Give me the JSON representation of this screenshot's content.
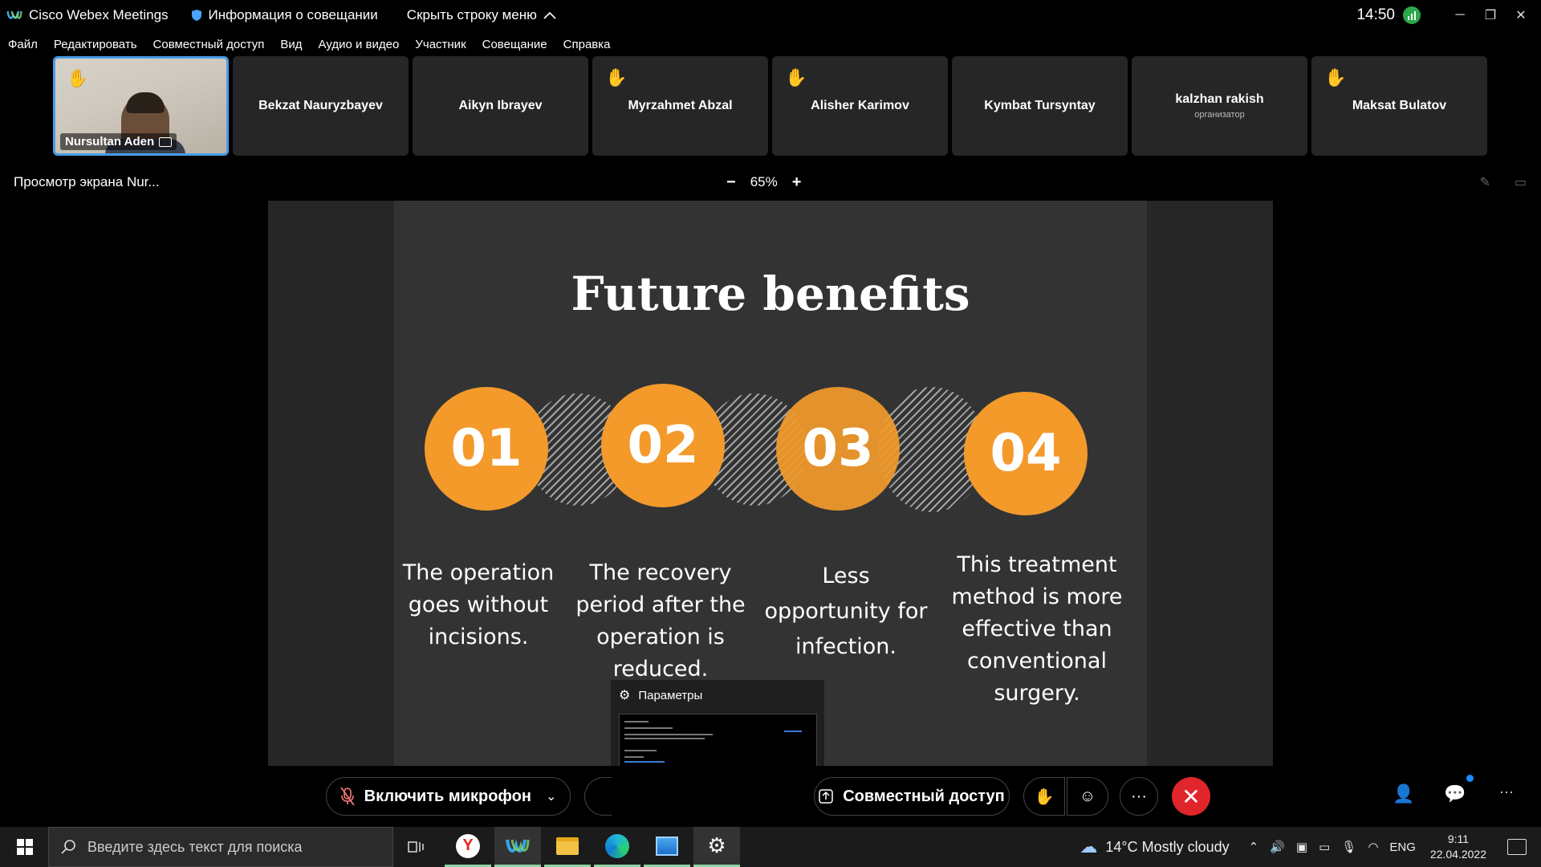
{
  "titlebar": {
    "app_title": "Cisco Webex Meetings",
    "meeting_info": "Информация о совещании",
    "hide_menu": "Скрыть строку меню",
    "clock": "14:50"
  },
  "menu": [
    "Файл",
    "Редактировать",
    "Совместный доступ",
    "Вид",
    "Аудио и видео",
    "Участник",
    "Совещание",
    "Справка"
  ],
  "participants": [
    {
      "name": "Nursultan Aden",
      "hand": true,
      "video": true
    },
    {
      "name": "Bekzat Nauryzbayev",
      "hand": false
    },
    {
      "name": "Aikyn Ibrayev",
      "hand": false
    },
    {
      "name": "Myrzahmet Abzal",
      "hand": true
    },
    {
      "name": "Alisher Karimov",
      "hand": true
    },
    {
      "name": "Kymbat Tursyntay",
      "hand": false
    },
    {
      "name": "kalzhan rakish",
      "role": "организатор",
      "hand": false
    },
    {
      "name": "Maksat Bulatov",
      "hand": true
    }
  ],
  "viewbar": {
    "title": "Просмотр экрана Nur...",
    "zoom_minus": "−",
    "zoom_level": "65%",
    "zoom_plus": "+"
  },
  "slide": {
    "title": "Future benefits",
    "numbers": [
      "01",
      "02",
      "03",
      "04"
    ],
    "points": [
      "The operation goes without incisions.",
      "The recovery period after the operation is reduced.",
      "Less opportunity for infection.",
      "This treatment method is more effective than conventional surgery."
    ]
  },
  "popup": {
    "title": "Параметры"
  },
  "controls": {
    "mic_label": "Включить микрофон",
    "share_label": "Совместный доступ"
  },
  "taskbar": {
    "search_placeholder": "Введите здесь текст для поиска",
    "weather": "14°C  Mostly cloudy",
    "lang": "ENG",
    "time": "9:11",
    "date": "22.04.2022"
  },
  "colors": {
    "accent_orange": "#f39a2b",
    "selected_border": "#4a9ce8",
    "end_call_red": "#e0262b",
    "raised_hand": "#f5a623"
  }
}
